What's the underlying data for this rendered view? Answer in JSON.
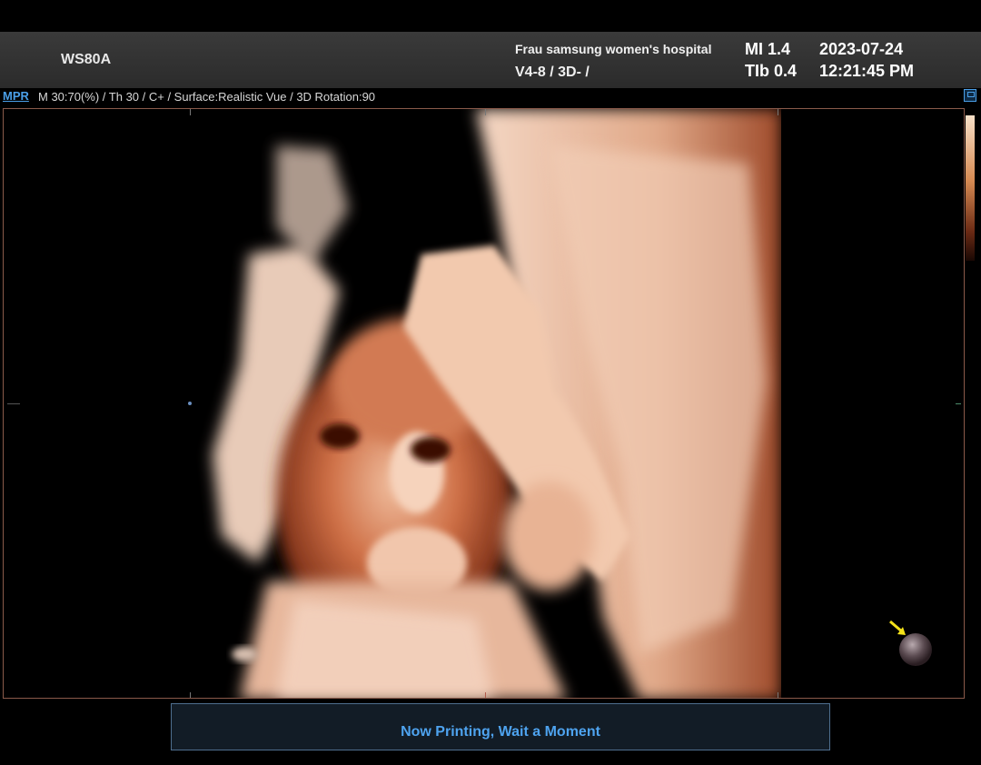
{
  "header": {
    "model": "WS80A",
    "hospital": "Frau samsung women's hospital",
    "probe_mode": "V4-8 / 3D- /",
    "mi": "MI  1.4",
    "tib": "TIb 0.4",
    "date": "2023-07-24",
    "time": "12:21:45 PM"
  },
  "infobar": {
    "mode_link": "MPR",
    "params": "M 30:70(%) / Th 30 / C+ / Surface:Realistic Vue / 3D Rotation:90"
  },
  "status": {
    "message": "Now Printing, Wait a Moment"
  },
  "colors": {
    "accent": "#4a9fe8",
    "tissue_light": "#f2d2bd",
    "tissue_mid": "#c8663e",
    "tissue_dark": "#5a1a08"
  },
  "icons": {
    "save": "save-icon",
    "orientation": "orientation-marker-icon"
  }
}
